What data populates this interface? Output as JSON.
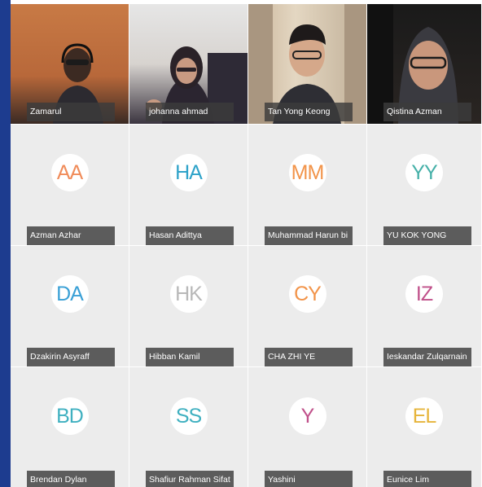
{
  "participants": [
    {
      "name": "Zamarul",
      "video": true,
      "scene": "s1"
    },
    {
      "name": "johanna ahmad",
      "video": true,
      "scene": "s2"
    },
    {
      "name": "Tan Yong Keong",
      "video": true,
      "scene": "s3"
    },
    {
      "name": "Qistina Azman",
      "video": true,
      "scene": "s4"
    },
    {
      "name": "Azman Azhar",
      "initials": "AA",
      "color": "#f08c5a"
    },
    {
      "name": "Hasan Adittya",
      "initials": "HA",
      "color": "#2fa3c9"
    },
    {
      "name": "Muhammad Harun bi",
      "initials": "MM",
      "color": "#f2944a"
    },
    {
      "name": "YU KOK YONG",
      "initials": "YY",
      "color": "#45b0a8"
    },
    {
      "name": "Dzakirin Asyraff",
      "initials": "DA",
      "color": "#3aa0d6"
    },
    {
      "name": "Hibban Kamil",
      "initials": "HK",
      "color": "#b8b8b8"
    },
    {
      "name": "CHA ZHI YE",
      "initials": "CY",
      "color": "#f2944a"
    },
    {
      "name": "Ieskandar Zulqarnain",
      "initials": "IZ",
      "color": "#c0508a"
    },
    {
      "name": "Brendan Dylan",
      "initials": "BD",
      "color": "#3fb0c0"
    },
    {
      "name": "Shafiur Rahman Sifat",
      "initials": "SS",
      "color": "#3fb0c0"
    },
    {
      "name": "Yashini",
      "initials": "Y",
      "color": "#c0508a"
    },
    {
      "name": "Eunice Lim",
      "initials": "EL",
      "color": "#e6b43a"
    }
  ]
}
